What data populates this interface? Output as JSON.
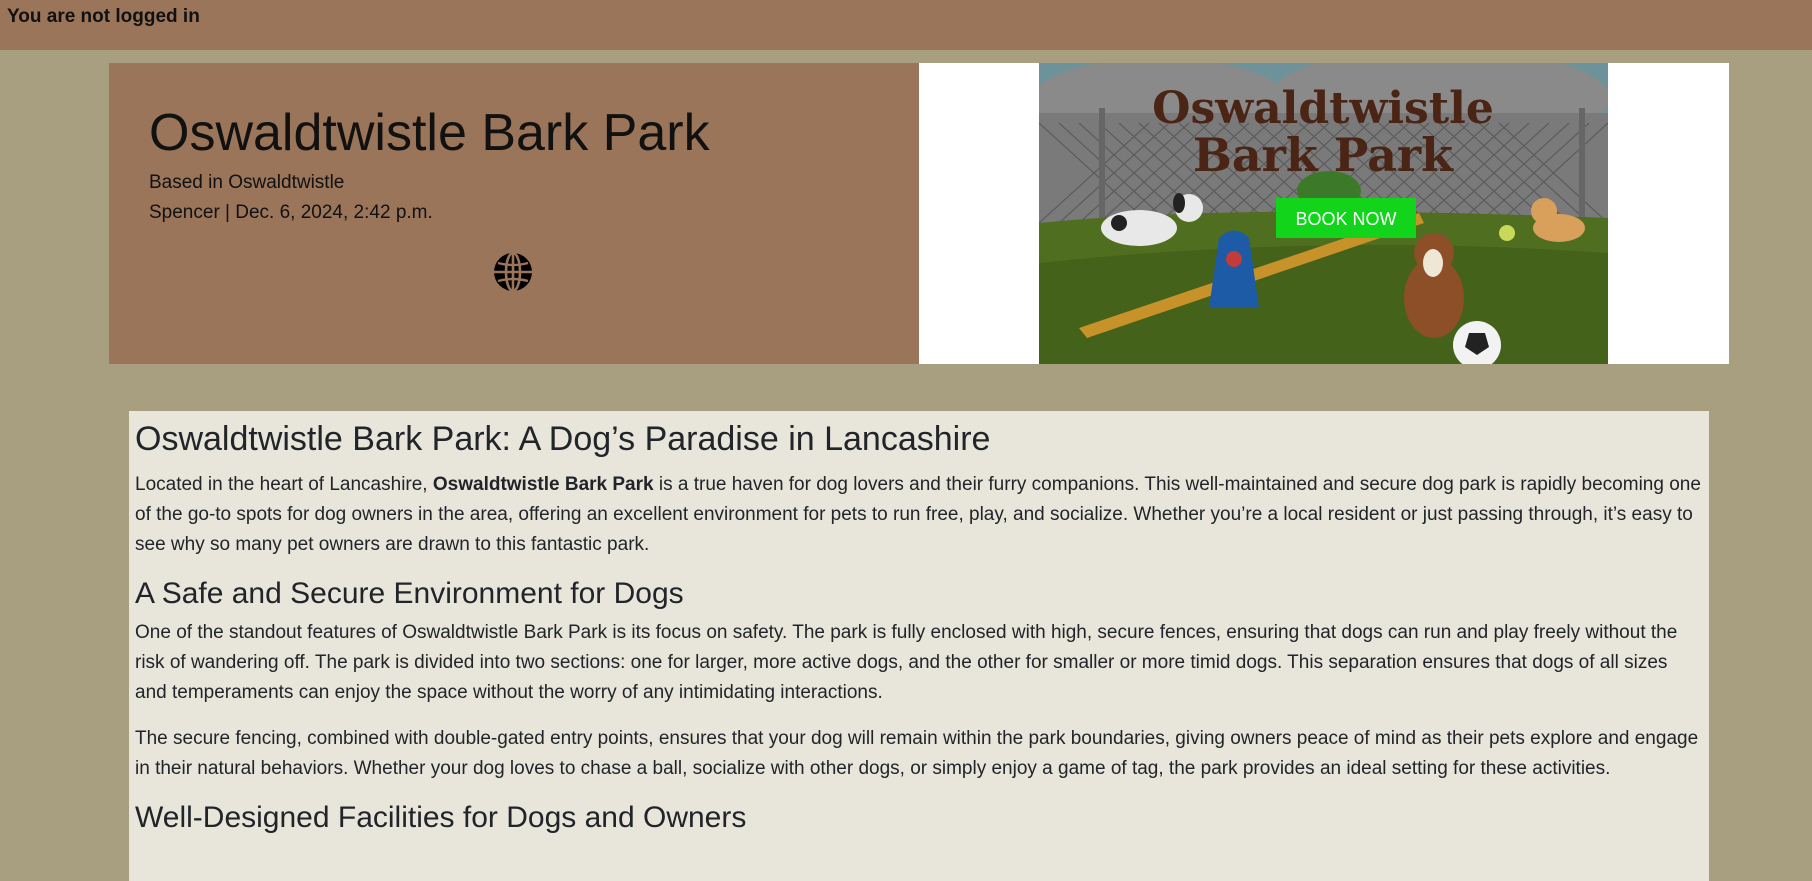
{
  "topbar": {
    "status_text": "You are not logged in"
  },
  "hero": {
    "title": "Oswaldtwistle Bark Park",
    "location": "Based in Oswaldtwistle",
    "meta": "Spencer | Dec. 6, 2024, 2:42 p.m.",
    "website_icon": "globe-icon"
  },
  "banner": {
    "line1": "Oswaldtwistle",
    "line2": "Bark Park",
    "cta": "BOOK NOW"
  },
  "article": {
    "heading": "Oswaldtwistle Bark Park: A Dog’s Paradise in Lancashire",
    "intro_before": "Located in the heart of Lancashire, ",
    "intro_bold": "Oswaldtwistle Bark Park",
    "intro_after": " is a true haven for dog lovers and their furry companions. This well-maintained and secure dog park is rapidly becoming one of the go-to spots for dog owners in the area, offering an excellent environment for pets to run free, play, and socialize. Whether you’re a local resident or just passing through, it’s easy to see why so many pet owners are drawn to this fantastic park.",
    "section1_heading": "A Safe and Secure Environment for Dogs",
    "section1_p1": "One of the standout features of Oswaldtwistle Bark Park is its focus on safety. The park is fully enclosed with high, secure fences, ensuring that dogs can run and play freely without the risk of wandering off. The park is divided into two sections: one for larger, more active dogs, and the other for smaller or more timid dogs. This separation ensures that dogs of all sizes and temperaments can enjoy the space without the worry of any intimidating interactions.",
    "section1_p2": "The secure fencing, combined with double-gated entry points, ensures that your dog will remain within the park boundaries, giving owners peace of mind as their pets explore and engage in their natural behaviors. Whether your dog loves to chase a ball, socialize with other dogs, or simply enjoy a game of tag, the park provides an ideal setting for these activities.",
    "section2_heading": "Well-Designed Facilities for Dogs and Owners"
  },
  "colors": {
    "page_bg": "#a89f80",
    "header_brown": "#9a755a",
    "content_bg": "#e8e5da",
    "cta_green": "#12d41a"
  }
}
